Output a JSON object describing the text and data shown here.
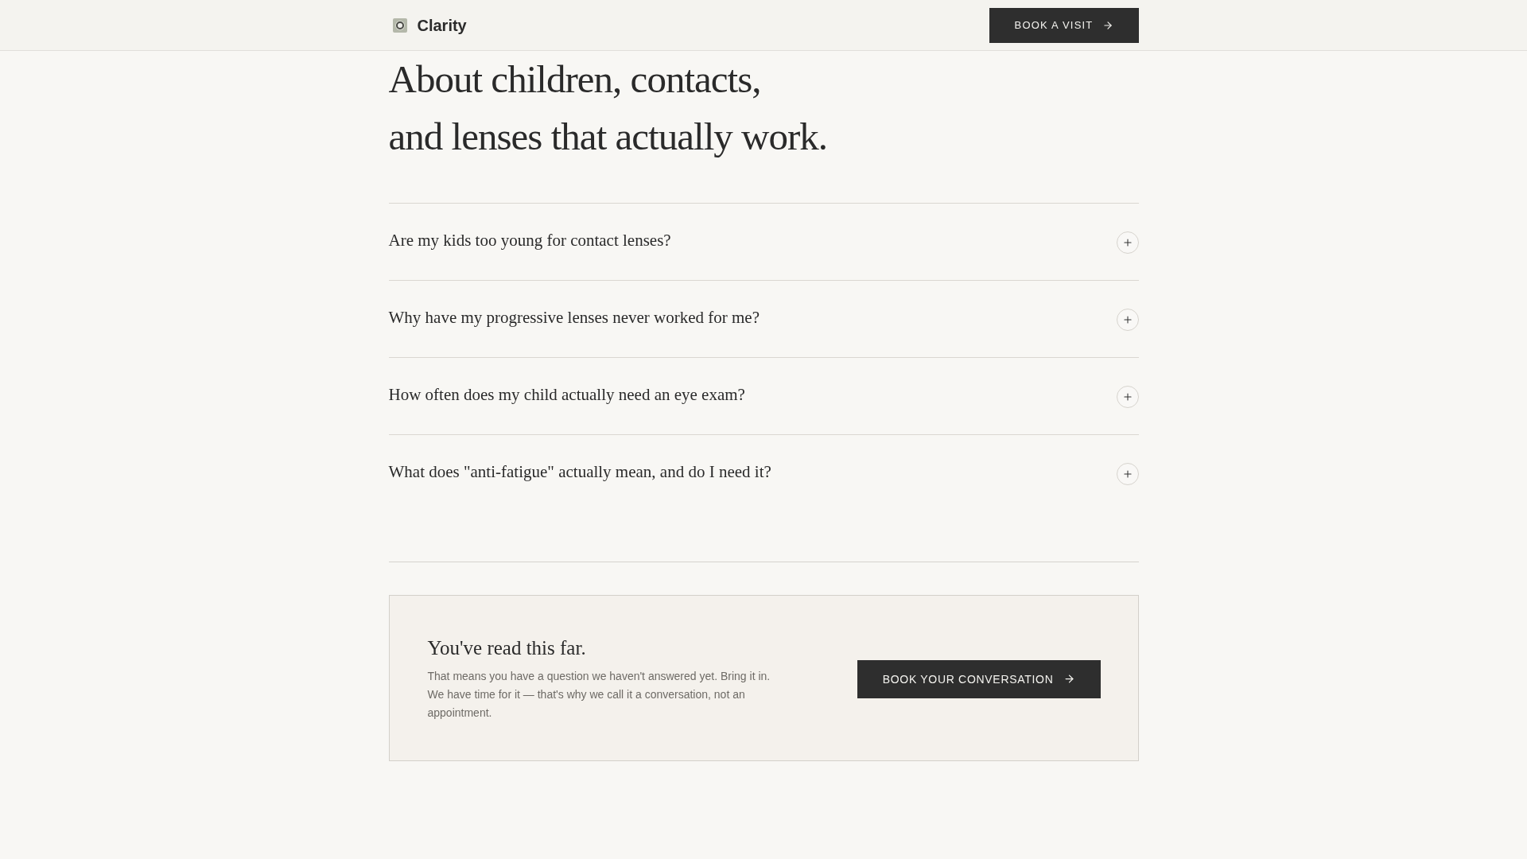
{
  "header": {
    "brand": "Clarity",
    "cta": {
      "label": "BOOK A VISIT"
    }
  },
  "heading": {
    "lines": [
      "About children, contacts,",
      "and lenses that actually work."
    ]
  },
  "faq": [
    {
      "question": "Are my kids too young for contact lenses?",
      "expanded": false
    },
    {
      "question": "Why have my progressive lenses never worked for me?",
      "expanded": false
    },
    {
      "question": "How often does my child actually need an eye exam?",
      "expanded": false
    },
    {
      "question": "What does \"anti-fatigue\" actually mean, and do I need it?",
      "expanded": false
    }
  ],
  "cta_panel": {
    "title": "You've read this far.",
    "body": "That means you have a question we haven't answered yet. Bring it in. We have time for it — that's why we call it a conversation, not an appointment.",
    "button": "BOOK YOUR CONVERSATION"
  }
}
